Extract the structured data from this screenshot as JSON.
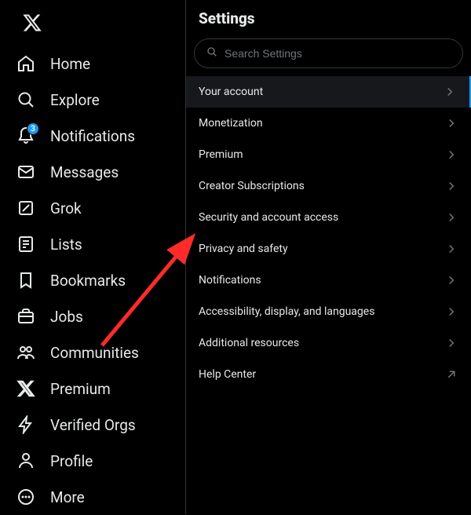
{
  "sidebar": {
    "items": [
      {
        "label": "Home",
        "name": "sidebar-item-home",
        "icon": "home-icon"
      },
      {
        "label": "Explore",
        "name": "sidebar-item-explore",
        "icon": "search-icon"
      },
      {
        "label": "Notifications",
        "name": "sidebar-item-notifications",
        "icon": "bell-icon",
        "badge": "3"
      },
      {
        "label": "Messages",
        "name": "sidebar-item-messages",
        "icon": "envelope-icon"
      },
      {
        "label": "Grok",
        "name": "sidebar-item-grok",
        "icon": "grok-icon"
      },
      {
        "label": "Lists",
        "name": "sidebar-item-lists",
        "icon": "list-icon"
      },
      {
        "label": "Bookmarks",
        "name": "sidebar-item-bookmarks",
        "icon": "bookmark-icon"
      },
      {
        "label": "Jobs",
        "name": "sidebar-item-jobs",
        "icon": "briefcase-icon"
      },
      {
        "label": "Communities",
        "name": "sidebar-item-communities",
        "icon": "people-icon"
      },
      {
        "label": "Premium",
        "name": "sidebar-item-premium",
        "icon": "x-icon"
      },
      {
        "label": "Verified Orgs",
        "name": "sidebar-item-verified-orgs",
        "icon": "lightning-icon"
      },
      {
        "label": "Profile",
        "name": "sidebar-item-profile",
        "icon": "person-icon"
      },
      {
        "label": "More",
        "name": "sidebar-item-more",
        "icon": "more-circle-icon"
      }
    ]
  },
  "main": {
    "title": "Settings",
    "search": {
      "placeholder": "Search Settings"
    },
    "items": [
      {
        "label": "Your account",
        "name": "settings-item-your-account",
        "selected": true,
        "end_icon": "chevron-right-icon"
      },
      {
        "label": "Monetization",
        "name": "settings-item-monetization",
        "end_icon": "chevron-right-icon"
      },
      {
        "label": "Premium",
        "name": "settings-item-premium",
        "end_icon": "chevron-right-icon"
      },
      {
        "label": "Creator Subscriptions",
        "name": "settings-item-creator-subscriptions",
        "end_icon": "chevron-right-icon"
      },
      {
        "label": "Security and account access",
        "name": "settings-item-security",
        "end_icon": "chevron-right-icon"
      },
      {
        "label": "Privacy and safety",
        "name": "settings-item-privacy",
        "end_icon": "chevron-right-icon"
      },
      {
        "label": "Notifications",
        "name": "settings-item-notifications",
        "end_icon": "chevron-right-icon"
      },
      {
        "label": "Accessibility, display, and languages",
        "name": "settings-item-accessibility",
        "end_icon": "chevron-right-icon"
      },
      {
        "label": "Additional resources",
        "name": "settings-item-additional",
        "end_icon": "chevron-right-icon"
      },
      {
        "label": "Help Center",
        "name": "settings-item-help",
        "end_icon": "external-link-icon"
      }
    ]
  },
  "annotation": {
    "arrow_color": "#ff2b2b"
  }
}
